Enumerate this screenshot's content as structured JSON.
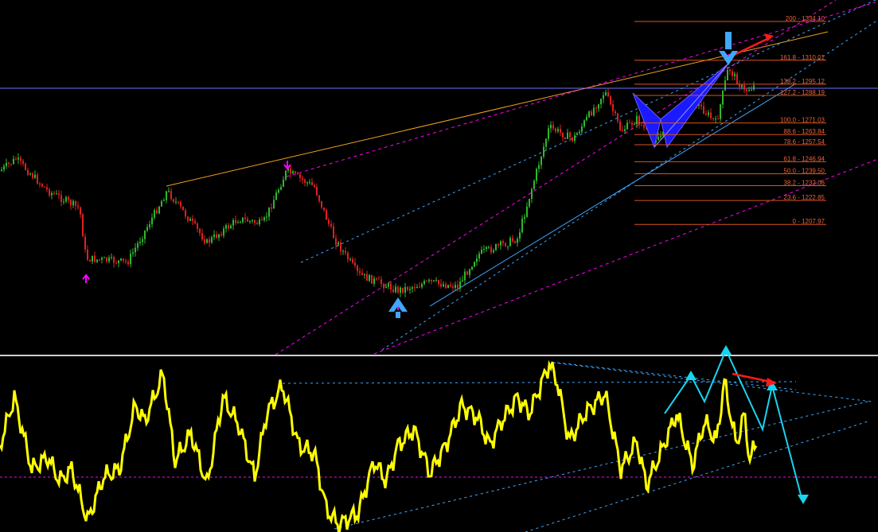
{
  "chart_data": [
    {
      "type": "candlestick",
      "title": "",
      "price_range": [
        1130,
        1345
      ],
      "colors": {
        "up": "#2eb82e",
        "down": "#e02020",
        "background": "#000000"
      },
      "fibonacci": [
        {
          "ratio": "200",
          "price": "1334.10",
          "level": 1334.1
        },
        {
          "ratio": "161.8",
          "price": "1310.01",
          "level": 1310.01
        },
        {
          "ratio": "138.2",
          "price": "1295.12",
          "level": 1295.12
        },
        {
          "ratio": "127.2",
          "price": "1288.19",
          "level": 1288.19
        },
        {
          "ratio": "100.0",
          "price": "1271.03",
          "level": 1271.03
        },
        {
          "ratio": "88.6",
          "price": "1263.84",
          "level": 1263.84
        },
        {
          "ratio": "78.6",
          "price": "1257.54",
          "level": 1257.54
        },
        {
          "ratio": "61.8",
          "price": "1246.94",
          "level": 1246.94
        },
        {
          "ratio": "50.0",
          "price": "1239.50",
          "level": 1239.5
        },
        {
          "ratio": "38.2",
          "price": "1232.06",
          "level": 1232.06
        },
        {
          "ratio": "23.6",
          "price": "1222.85",
          "level": 1222.85
        },
        {
          "ratio": "0",
          "price": "1207.97",
          "level": 1207.97
        }
      ],
      "horizontal_line": {
        "price": 1271.03,
        "color": "#6b73ff"
      },
      "markers": [
        {
          "kind": "up-arrow",
          "color": "#ff00ff"
        },
        {
          "kind": "down-arrow",
          "color": "#ff00ff"
        },
        {
          "kind": "up-arrow",
          "color": "#ff00ff"
        },
        {
          "kind": "down-arrow",
          "color": "#ff00ff"
        },
        {
          "kind": "pattern-arrow-up",
          "color": "#3fa7ff"
        },
        {
          "kind": "pattern-arrow-down",
          "color": "#3fa7ff"
        }
      ],
      "harmonic_pattern_color": "#1a1aff"
    },
    {
      "type": "line",
      "title": "",
      "series": [
        {
          "color": "#ffff00"
        }
      ],
      "reference_line_color": "#ff00ff",
      "projection_color": "#17d4f0",
      "arrow_color": "#ff1a1a"
    }
  ]
}
